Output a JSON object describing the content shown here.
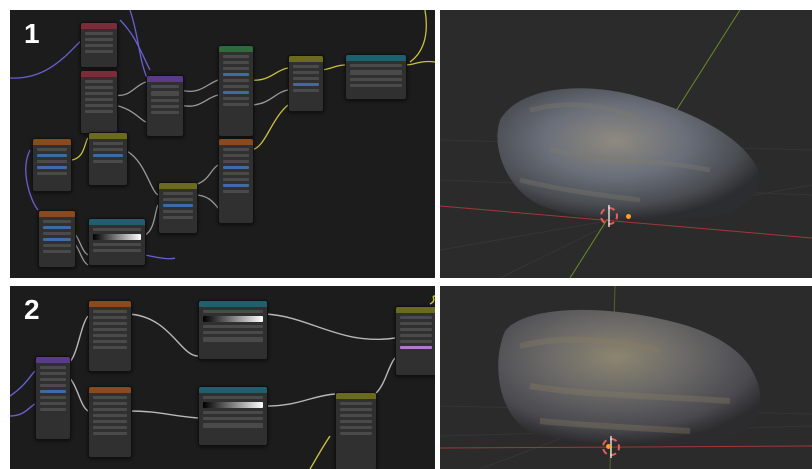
{
  "panels": [
    {
      "number": "1"
    },
    {
      "number": "2"
    }
  ],
  "colors": {
    "node_editor_bg": "#1c1c1c",
    "viewport_bg": "#2b2b2b",
    "wire_yellow": "#c8c23a",
    "wire_purple": "#6a5fd0",
    "wire_gray": "#b8b8b8",
    "axis_red": "#a03838",
    "axis_green": "#6a8a2a"
  },
  "icons": [
    "3d-cursor-icon",
    "origin-dot-icon"
  ]
}
